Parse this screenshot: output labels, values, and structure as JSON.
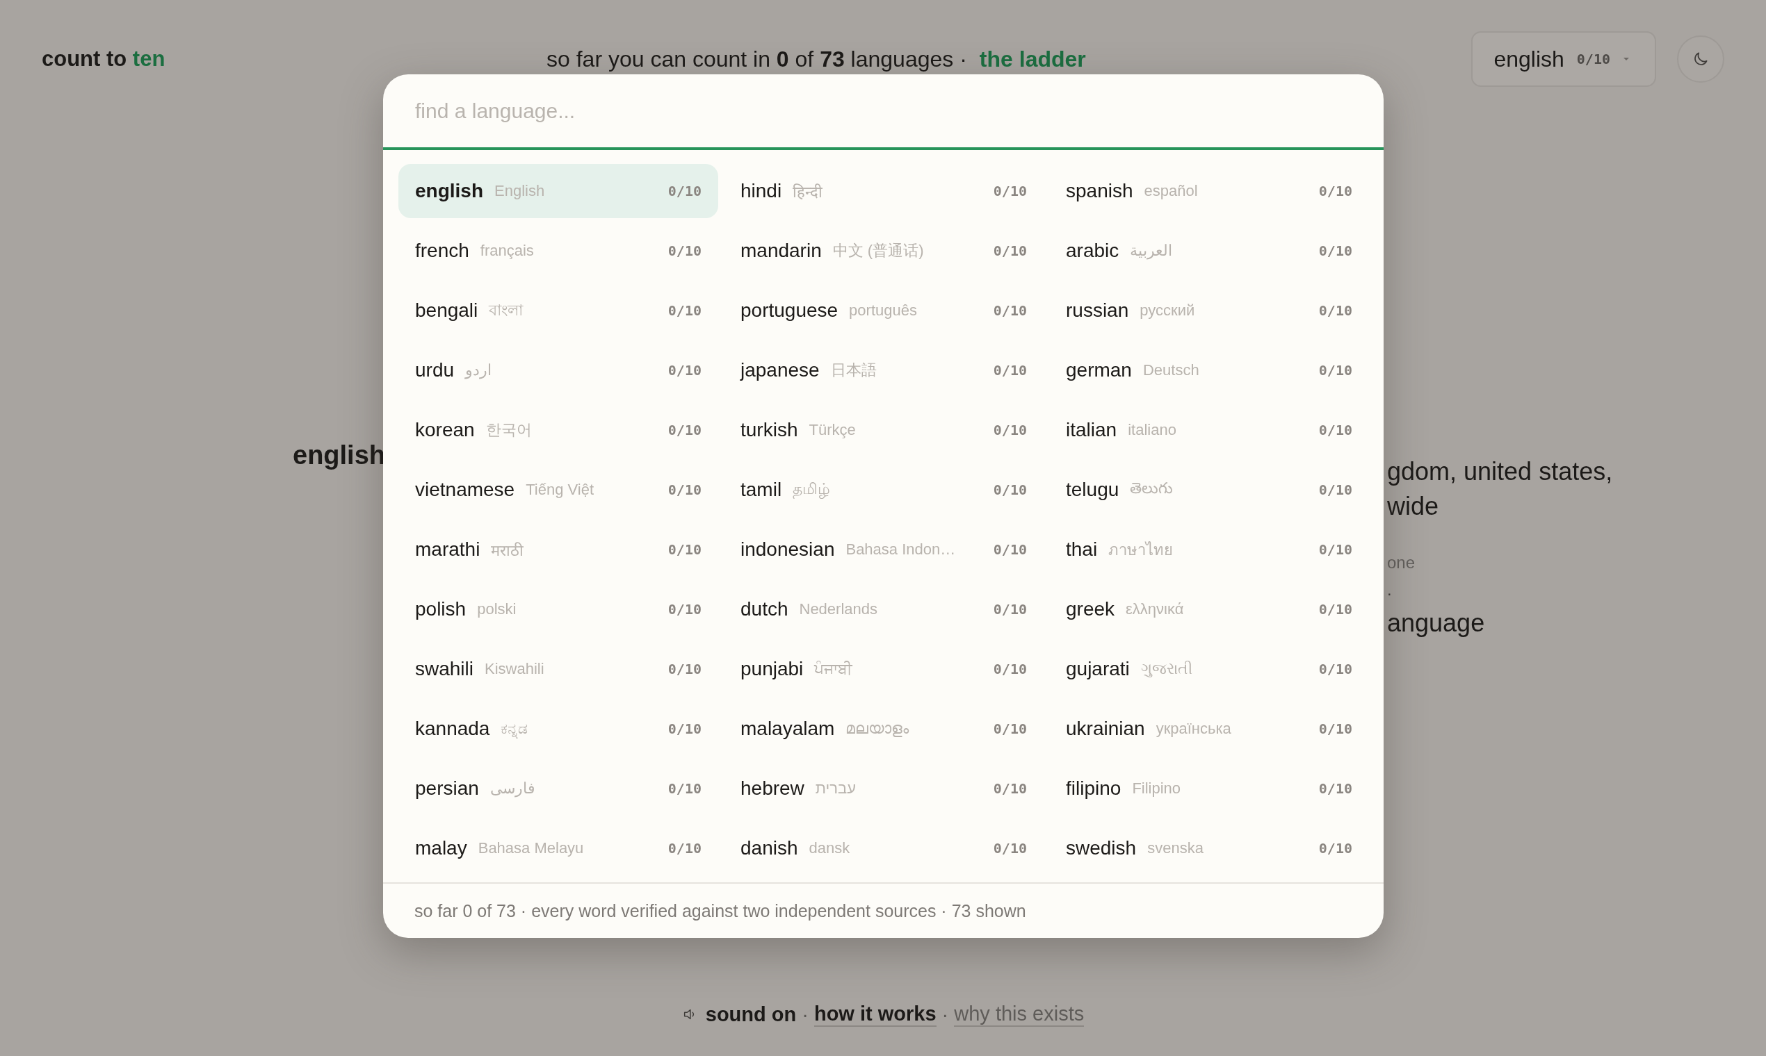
{
  "header": {
    "logo": {
      "text": "count to",
      "accent": "ten"
    },
    "progress": "so far you can count in **0** of **73** languages ·",
    "ladder_link": "the ladder",
    "language_picker": {
      "label": "english",
      "count": "0/10"
    }
  },
  "background": {
    "language_title": "english",
    "region_lines": [
      "gdom, united states,",
      "wide"
    ],
    "note": "one",
    "mark": ".",
    "subtitle": "anguage"
  },
  "dialog": {
    "search": {
      "placeholder": "find a language..."
    },
    "languages": [
      {
        "name": "english",
        "native": "English",
        "count": "0/10",
        "selected": true
      },
      {
        "name": "hindi",
        "native": "हिन्दी",
        "count": "0/10",
        "selected": false
      },
      {
        "name": "spanish",
        "native": "español",
        "count": "0/10",
        "selected": false
      },
      {
        "name": "french",
        "native": "français",
        "count": "0/10",
        "selected": false
      },
      {
        "name": "mandarin",
        "native": "中文 (普通话)",
        "count": "0/10",
        "selected": false
      },
      {
        "name": "arabic",
        "native": "العربية",
        "count": "0/10",
        "selected": false
      },
      {
        "name": "bengali",
        "native": "বাংলা",
        "count": "0/10",
        "selected": false
      },
      {
        "name": "portuguese",
        "native": "português",
        "count": "0/10",
        "selected": false
      },
      {
        "name": "russian",
        "native": "русский",
        "count": "0/10",
        "selected": false
      },
      {
        "name": "urdu",
        "native": "اردو",
        "count": "0/10",
        "selected": false
      },
      {
        "name": "japanese",
        "native": "日本語",
        "count": "0/10",
        "selected": false
      },
      {
        "name": "german",
        "native": "Deutsch",
        "count": "0/10",
        "selected": false
      },
      {
        "name": "korean",
        "native": "한국어",
        "count": "0/10",
        "selected": false
      },
      {
        "name": "turkish",
        "native": "Türkçe",
        "count": "0/10",
        "selected": false
      },
      {
        "name": "italian",
        "native": "italiano",
        "count": "0/10",
        "selected": false
      },
      {
        "name": "vietnamese",
        "native": "Tiếng Việt",
        "count": "0/10",
        "selected": false
      },
      {
        "name": "tamil",
        "native": "தமிழ்",
        "count": "0/10",
        "selected": false
      },
      {
        "name": "telugu",
        "native": "తెలుగు",
        "count": "0/10",
        "selected": false
      },
      {
        "name": "marathi",
        "native": "मराठी",
        "count": "0/10",
        "selected": false
      },
      {
        "name": "indonesian",
        "native": "Bahasa Indon…",
        "count": "0/10",
        "selected": false
      },
      {
        "name": "thai",
        "native": "ภาษาไทย",
        "count": "0/10",
        "selected": false
      },
      {
        "name": "polish",
        "native": "polski",
        "count": "0/10",
        "selected": false
      },
      {
        "name": "dutch",
        "native": "Nederlands",
        "count": "0/10",
        "selected": false
      },
      {
        "name": "greek",
        "native": "ελληνικά",
        "count": "0/10",
        "selected": false
      },
      {
        "name": "swahili",
        "native": "Kiswahili",
        "count": "0/10",
        "selected": false
      },
      {
        "name": "punjabi",
        "native": "ਪੰਜਾਬੀ",
        "count": "0/10",
        "selected": false
      },
      {
        "name": "gujarati",
        "native": "ગુજરાતી",
        "count": "0/10",
        "selected": false
      },
      {
        "name": "kannada",
        "native": "ಕನ್ನಡ",
        "count": "0/10",
        "selected": false
      },
      {
        "name": "malayalam",
        "native": "മലയാളം",
        "count": "0/10",
        "selected": false
      },
      {
        "name": "ukrainian",
        "native": "українська",
        "count": "0/10",
        "selected": false
      },
      {
        "name": "persian",
        "native": "فارسی",
        "count": "0/10",
        "selected": false
      },
      {
        "name": "hebrew",
        "native": "עברית",
        "count": "0/10",
        "selected": false
      },
      {
        "name": "filipino",
        "native": "Filipino",
        "count": "0/10",
        "selected": false
      },
      {
        "name": "malay",
        "native": "Bahasa Melayu",
        "count": "0/10",
        "selected": false
      },
      {
        "name": "danish",
        "native": "dansk",
        "count": "0/10",
        "selected": false
      },
      {
        "name": "swedish",
        "native": "svenska",
        "count": "0/10",
        "selected": false
      }
    ],
    "footer": "so far 0 of 73 · every word verified against two independent sources · 73 shown"
  },
  "footer_links": [
    {
      "kind": "sound",
      "text": "sound on"
    },
    {
      "kind": "separator",
      "text": "·"
    },
    {
      "kind": "link",
      "text": "how it works"
    },
    {
      "kind": "separator",
      "text": "·"
    },
    {
      "kind": "muted-link",
      "text": "why this exists"
    }
  ]
}
